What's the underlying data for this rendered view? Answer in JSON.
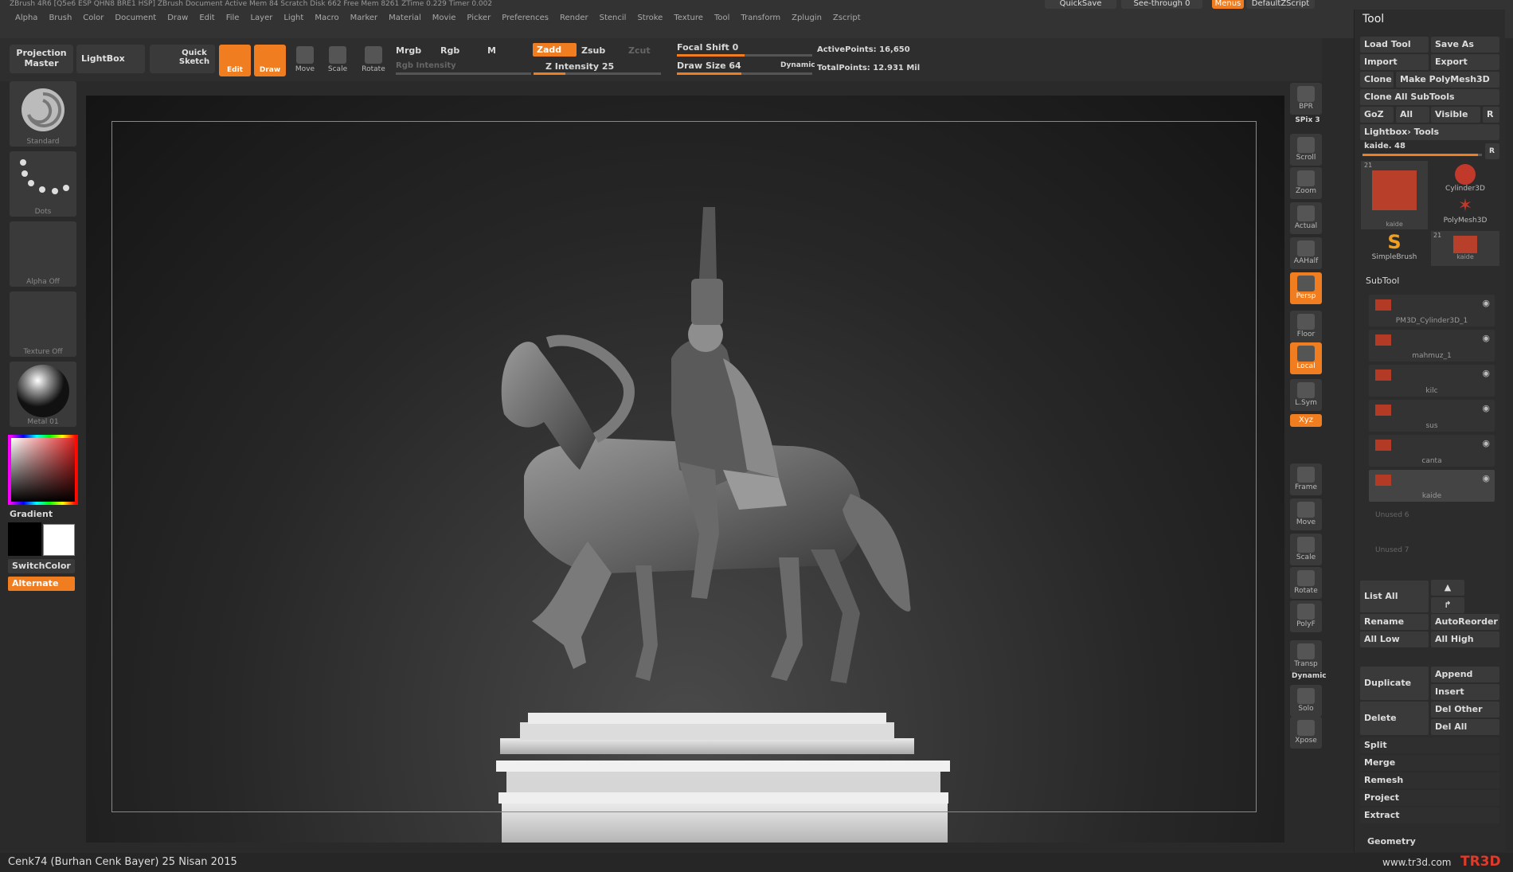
{
  "app": {
    "title": "ZBrush 4R6 [Q5e6 ESP QHN8 BRE1 HSP] ZBrush Document  Active Mem 84 Scratch Disk 662 Free Mem 8261 ZTime 0.229 Timer 0.002"
  },
  "menu": [
    "Alpha",
    "Brush",
    "Color",
    "Document",
    "Draw",
    "Edit",
    "File",
    "Layer",
    "Light",
    "Macro",
    "Marker",
    "Material",
    "Movie",
    "Picker",
    "Preferences",
    "Render",
    "Stencil",
    "Stroke",
    "Texture",
    "Tool",
    "Transform",
    "Zplugin",
    "Zscript"
  ],
  "topbar": {
    "quicksave": "QuickSave",
    "seethrough": "See-through 0",
    "menus": "Menus",
    "script": "DefaultZScript"
  },
  "shelf": {
    "projection_master": "Projection Master",
    "lightbox": "LightBox",
    "quick_sketch": "Quick Sketch",
    "edit": "Edit",
    "draw": "Draw",
    "move": "Move",
    "scale": "Scale",
    "rotate": "Rotate",
    "mrgb": "Mrgb",
    "rgb": "Rgb",
    "m": "M",
    "zadd": "Zadd",
    "zsub": "Zsub",
    "zcut": "Zcut",
    "rgb_intensity": "Rgb Intensity",
    "z_intensity": "Z Intensity 25",
    "focal_shift": "Focal Shift 0",
    "draw_size": "Draw Size 64",
    "dynamic": "Dynamic",
    "active_points": "ActivePoints: 16,650",
    "total_points": "TotalPoints: 12.931 Mil",
    "z_intensity_value": 25,
    "draw_size_value": 64
  },
  "left": {
    "standard": "Standard",
    "dots": "Dots",
    "alpha_off": "Alpha Off",
    "texture_off": "Texture Off",
    "metal": "Metal 01",
    "gradient": "Gradient",
    "switchcolor": "SwitchColor",
    "alternate": "Alternate"
  },
  "rtool": [
    "BPR",
    "SPix 3",
    "Scroll",
    "Zoom",
    "Actual",
    "AAHalf",
    "Persp",
    "Floor",
    "Local",
    "L.Sym",
    "Xyz",
    "Frame",
    "Move",
    "Scale",
    "Rotate",
    "PolyF",
    "Transp",
    "Dynamic",
    "Solo",
    "Xpose"
  ],
  "panel": {
    "title": "Tool",
    "load_tool": "Load Tool",
    "save_as": "Save As",
    "import": "Import",
    "export": "Export",
    "clone": "Clone",
    "make_polymesh": "Make PolyMesh3D",
    "clone_all": "Clone All SubTools",
    "goz": "GoZ",
    "all": "All",
    "visible": "Visible",
    "r": "R",
    "lightbox_tools": "Lightbox› Tools",
    "kaide": "kaide. 48",
    "tools": [
      "kaide",
      "Cylinder3D",
      "PolyMesh3D",
      "SimpleBrush",
      "kaide"
    ],
    "tool_count": "21",
    "subtool": "SubTool",
    "subtools": [
      "PM3D_Cylinder3D_1",
      "mahmuz_1",
      "kilc",
      "sus",
      "canta",
      "kaide"
    ],
    "unused": [
      "Unused 6",
      "Unused 7"
    ],
    "list_all": "List All",
    "rename": "Rename",
    "autoreorder": "AutoReorder",
    "all_low": "All Low",
    "all_high": "All High",
    "duplicate": "Duplicate",
    "append": "Append",
    "insert": "Insert",
    "delete": "Delete",
    "del_other": "Del Other",
    "del_all": "Del All",
    "split": "Split",
    "merge": "Merge",
    "remesh": "Remesh",
    "project": "Project",
    "extract": "Extract",
    "geometry": "Geometry"
  },
  "status": {
    "credit": "Cenk74 (Burhan Cenk Bayer)  25 Nisan 2015",
    "url": "www.tr3d.com",
    "logo": "TR3D"
  }
}
